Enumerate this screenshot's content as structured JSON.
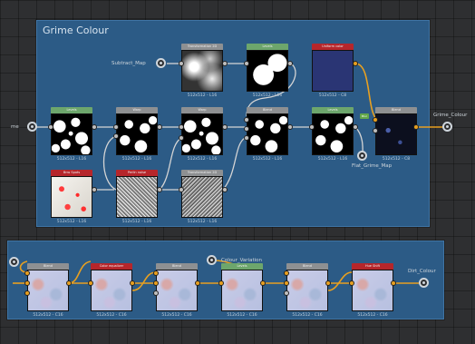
{
  "frames": {
    "grime": {
      "title": "Grime Colour"
    },
    "dirt": {
      "title": ""
    }
  },
  "io": {
    "subtract_map": "Subtract_Map",
    "in_left": "me",
    "grime_colour_out": "Grime_Colour",
    "flat_grime_map": "Flat_Grime_Map",
    "colour_variation": "Colour_Variation",
    "dirt_colour_out": "Dirt_Colour"
  },
  "nodes": {
    "n1": {
      "title": "Levels",
      "sub": "512x512 - L16"
    },
    "n2": {
      "title": "Warp",
      "sub": "512x512 - L16"
    },
    "n3": {
      "title": "Warp",
      "sub": "512x512 - L16"
    },
    "n4": {
      "title": "Transformation 2D",
      "sub": "512x512 - L16"
    },
    "n5": {
      "title": "Levels",
      "sub": "512x512 - L16"
    },
    "n6": {
      "title": "Blend",
      "sub": "512x512 - L16"
    },
    "n7": {
      "title": "Levels",
      "sub": "512x512 - L16"
    },
    "n8": {
      "title": "Uniform color",
      "sub": "512x512 - C8"
    },
    "n9": {
      "title": "Blend",
      "sub": "512x512 - C8"
    },
    "n10": {
      "title": "Bnw Spots",
      "sub": "512x512 - L16"
    },
    "n11": {
      "title": "Perlin noise",
      "sub": "512x512 - L16"
    },
    "n12": {
      "title": "Transformation 2D",
      "sub": "512x512 - L16"
    },
    "b1": {
      "title": "Blend",
      "sub": "512x512 - C16"
    },
    "b2": {
      "title": "Color equalizer",
      "sub": "512x512 - C16"
    },
    "b3": {
      "title": "Blend",
      "sub": "512x512 - C16"
    },
    "b4": {
      "title": "Levels",
      "sub": "512x512 - C16"
    },
    "b5": {
      "title": "Blend",
      "sub": "512x512 - C16"
    },
    "b6": {
      "title": "Hue Shift",
      "sub": "512x512 - C16"
    }
  },
  "pill": "Blur"
}
